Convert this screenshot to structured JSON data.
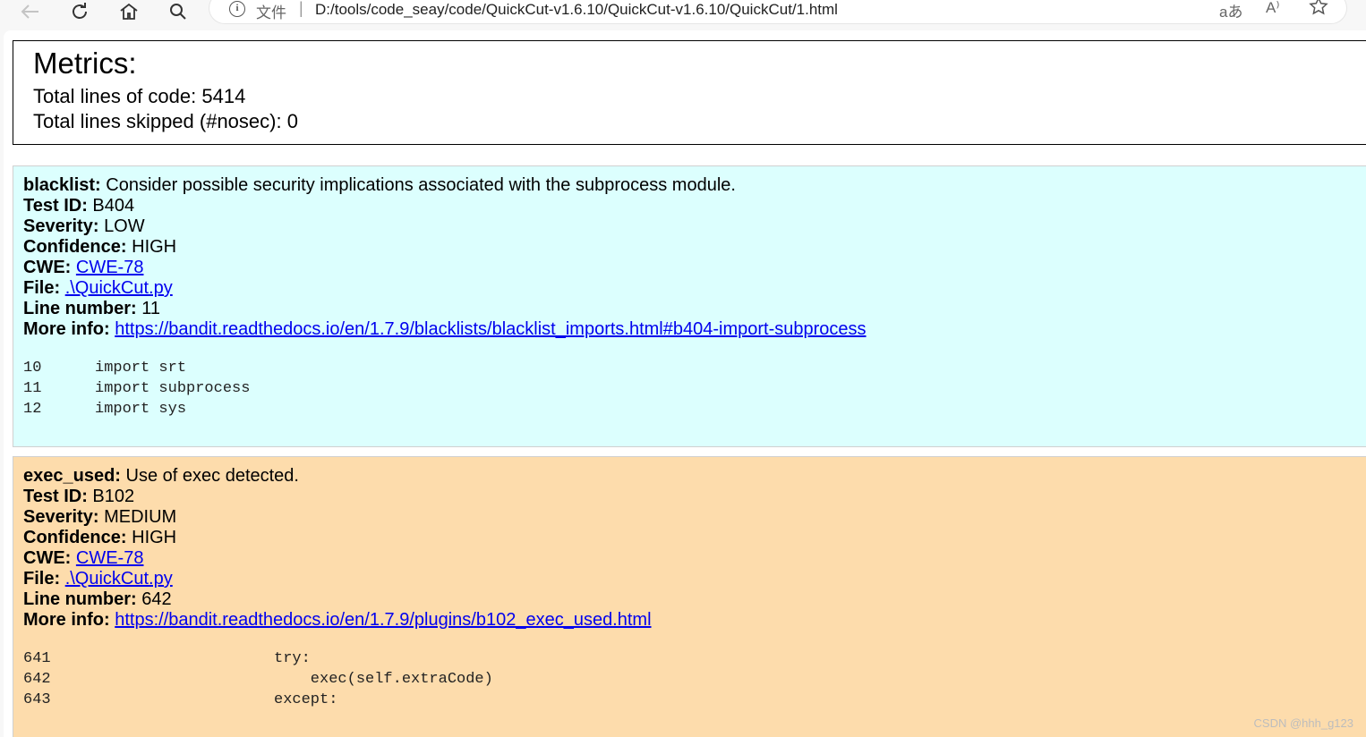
{
  "browser": {
    "url_scheme": "文件",
    "separator": "|",
    "url": "D:/tools/code_seay/code/QuickCut-v1.6.10/QuickCut-v1.6.10/QuickCut/1.html",
    "translate_label": "aあ",
    "read_aloud_label": "A⁾"
  },
  "metrics": {
    "title": "Metrics:",
    "total_lines_label": "Total lines of code:",
    "total_lines": "5414",
    "skipped_label": "Total lines skipped (#nosec):",
    "skipped": "0"
  },
  "issues": [
    {
      "name": "blacklist:",
      "description": "Consider possible security implications associated with the subprocess module.",
      "test_id_label": "Test ID:",
      "test_id": "B404",
      "severity_label": "Severity:",
      "severity": "LOW",
      "confidence_label": "Confidence:",
      "confidence": "HIGH",
      "cwe_label": "CWE:",
      "cwe": "CWE-78",
      "file_label": "File:",
      "file": ".\\QuickCut.py",
      "line_label": "Line number:",
      "line": "11",
      "more_info_label": "More info:",
      "more_info": "https://bandit.readthedocs.io/en/1.7.9/blacklists/blacklist_imports.html#b404-import-subprocess",
      "code": [
        {
          "num": "10",
          "text": "import srt"
        },
        {
          "num": "11",
          "text": "import subprocess"
        },
        {
          "num": "12",
          "text": "import sys"
        }
      ],
      "bg_color": "#dcfffe"
    },
    {
      "name": "exec_used:",
      "description": "Use of exec detected.",
      "test_id_label": "Test ID:",
      "test_id": "B102",
      "severity_label": "Severity:",
      "severity": "MEDIUM",
      "confidence_label": "Confidence:",
      "confidence": "HIGH",
      "cwe_label": "CWE:",
      "cwe": "CWE-78",
      "file_label": "File:",
      "file": ".\\QuickCut.py",
      "line_label": "Line number:",
      "line": "642",
      "more_info_label": "More info:",
      "more_info": "https://bandit.readthedocs.io/en/1.7.9/plugins/b102_exec_used.html",
      "code": [
        {
          "num": "641",
          "text": "try:"
        },
        {
          "num": "642",
          "text": "    exec(self.extraCode)"
        },
        {
          "num": "643",
          "text": "except:"
        }
      ],
      "bg_color": "#fddcac"
    }
  ],
  "watermark": "CSDN @hhh_g123"
}
